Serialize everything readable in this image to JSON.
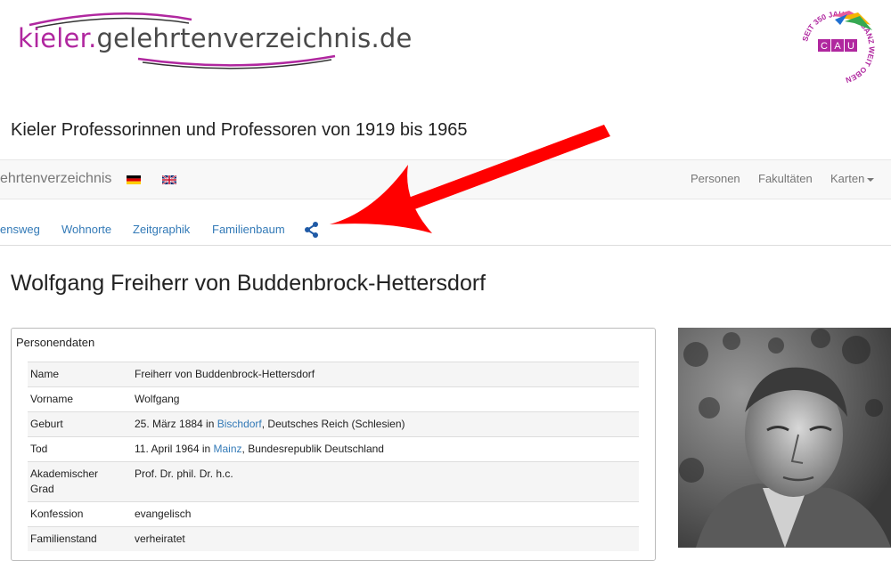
{
  "logo": {
    "part1": "kieler",
    "part2": ".",
    "part3": "gelehrtenverzeichnis.de"
  },
  "seal": {
    "letters": [
      "C",
      "A",
      "U"
    ],
    "ring_text": "SEIT 350 JAHREN GANZ WEIT OBEN"
  },
  "header": {
    "subtitle": "Kieler Professorinnen und Professoren von 1919 bis 1965"
  },
  "navbar": {
    "brand": "ehrtenverzeichnis",
    "flags": [
      "flag-de-icon",
      "flag-gb-icon"
    ],
    "items": [
      "Personen",
      "Fakultäten",
      "Karten"
    ]
  },
  "subnav": {
    "items": [
      "ensweg",
      "Wohnorte",
      "Zeitgraphik",
      "Familienbaum"
    ],
    "icon": "network-icon"
  },
  "person": {
    "name": "Wolfgang Freiherr von Buddenbrock-Hettersdorf",
    "panel_title": "Personendaten",
    "rows": [
      {
        "key": "Name",
        "value": "Freiherr von Buddenbrock-Hettersdorf"
      },
      {
        "key": "Vorname",
        "value": "Wolfgang"
      },
      {
        "key": "Geburt",
        "prefix": "25. März 1884 in ",
        "link": "Bischdorf",
        "suffix": ", Deutsches Reich (Schlesien)"
      },
      {
        "key": "Tod",
        "prefix": "11. April 1964 in ",
        "link": "Mainz",
        "suffix": ", Bundesrepublik Deutschland"
      },
      {
        "key": "Akademischer Grad",
        "value": "Prof. Dr. phil. Dr. h.c."
      },
      {
        "key": "Konfession",
        "value": "evangelisch"
      },
      {
        "key": "Familienstand",
        "value": "verheiratet"
      }
    ]
  },
  "colors": {
    "link": "#337ab7",
    "brand_magenta": "#b0279f",
    "arrow": "#ff0000"
  }
}
